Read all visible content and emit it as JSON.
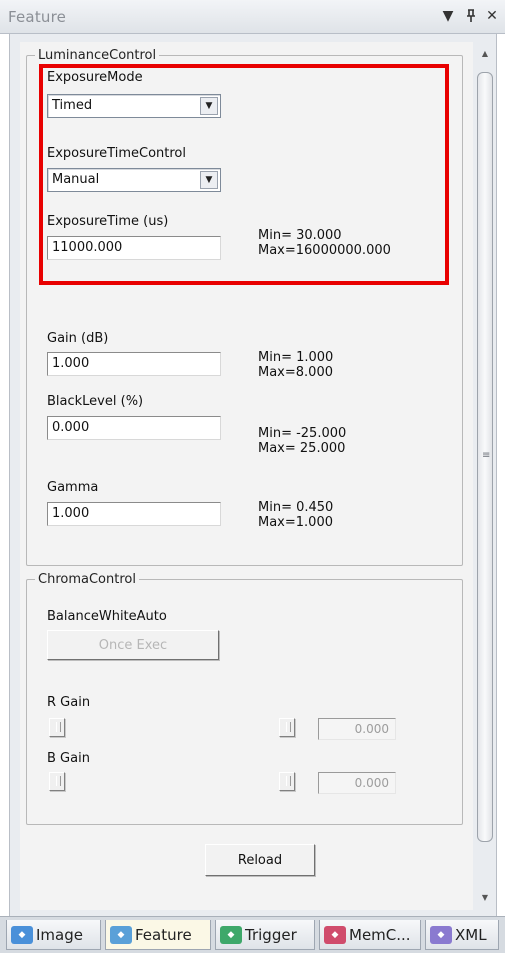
{
  "window": {
    "title": "Feature"
  },
  "luminance": {
    "group_label": "LuminanceControl",
    "exposure_mode": {
      "label": "ExposureMode",
      "value": "Timed"
    },
    "exposure_time_control": {
      "label": "ExposureTimeControl",
      "value": "Manual"
    },
    "exposure_time": {
      "label": "ExposureTime (us)",
      "value": "11000.000",
      "min": "Min= 30.000",
      "max": "Max=16000000.000"
    },
    "gain": {
      "label": "Gain (dB)",
      "value": "1.000",
      "min": "Min= 1.000",
      "max": "Max=8.000"
    },
    "black_level": {
      "label": "BlackLevel (%)",
      "value": "0.000",
      "min": "Min= -25.000",
      "max": "Max= 25.000"
    },
    "gamma": {
      "label": "Gamma",
      "value": "1.000",
      "min": "Min= 0.450",
      "max": "Max=1.000"
    }
  },
  "chroma": {
    "group_label": "ChromaControl",
    "balance_white_auto": {
      "label": "BalanceWhiteAuto",
      "button_label": "Once Exec"
    },
    "r_gain": {
      "label": "R Gain",
      "value": "0.000"
    },
    "b_gain": {
      "label": "B Gain",
      "value": "0.000"
    }
  },
  "reload_label": "Reload",
  "tabs": [
    {
      "label": "Image",
      "icon": "image-tab-icon",
      "color": "#4a90d9"
    },
    {
      "label": "Feature",
      "icon": "feature-tab-icon",
      "color": "#5aa0d8"
    },
    {
      "label": "Trigger",
      "icon": "trigger-tab-icon",
      "color": "#3ea86a"
    },
    {
      "label": "MemC...",
      "icon": "memory-tab-icon",
      "color": "#d04c6c"
    },
    {
      "label": "XML",
      "icon": "xml-tab-icon",
      "color": "#8a7ad0"
    }
  ],
  "colors": {
    "highlight": "#e80000",
    "active_tab": "#fbf8e6"
  }
}
